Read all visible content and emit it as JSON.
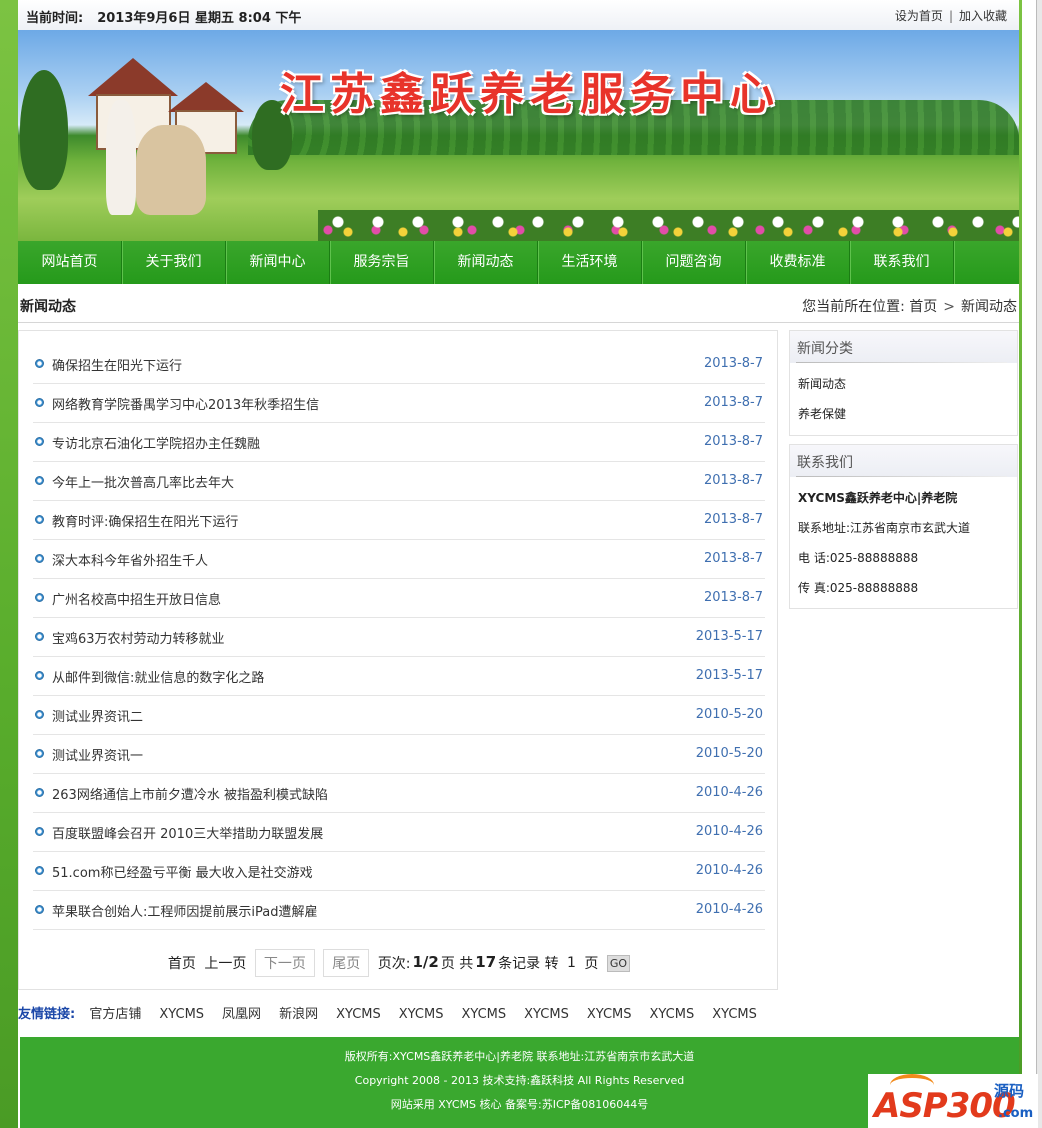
{
  "topbar": {
    "time_label": "当前时间:",
    "time_value": "2013年9月6日  星期五  8:04  下午",
    "set_home": "设为首页",
    "separator": "|",
    "add_fav": "加入收藏"
  },
  "banner": {
    "title": "江苏鑫跃养老服务中心"
  },
  "nav": [
    "网站首页",
    "关于我们",
    "新闻中心",
    "服务宗旨",
    "新闻动态",
    "生活环境",
    "问题咨询",
    "收费标准",
    "联系我们"
  ],
  "section": {
    "title": "新闻动态",
    "crumb_prefix": "您当前所在位置:",
    "crumb_home": "首页",
    "crumb_sep": ">",
    "crumb_current": "新闻动态"
  },
  "news": [
    {
      "title": "确保招生在阳光下运行",
      "date": "2013-8-7"
    },
    {
      "title": "网络教育学院番禺学习中心2013年秋季招生信",
      "date": "2013-8-7"
    },
    {
      "title": "专访北京石油化工学院招办主任魏融",
      "date": "2013-8-7"
    },
    {
      "title": "今年上一批次普高几率比去年大",
      "date": "2013-8-7"
    },
    {
      "title": "教育时评:确保招生在阳光下运行",
      "date": "2013-8-7"
    },
    {
      "title": "深大本科今年省外招生千人",
      "date": "2013-8-7"
    },
    {
      "title": "广州名校高中招生开放日信息",
      "date": "2013-8-7"
    },
    {
      "title": "宝鸡63万农村劳动力转移就业",
      "date": "2013-5-17"
    },
    {
      "title": "从邮件到微信:就业信息的数字化之路",
      "date": "2013-5-17"
    },
    {
      "title": "测试业界资讯二",
      "date": "2010-5-20"
    },
    {
      "title": "测试业界资讯一",
      "date": "2010-5-20"
    },
    {
      "title": "263网络通信上市前夕遭冷水 被指盈利模式缺陷",
      "date": "2010-4-26"
    },
    {
      "title": "百度联盟峰会召开 2010三大举措助力联盟发展",
      "date": "2010-4-26"
    },
    {
      "title": "51.com称已经盈亏平衡 最大收入是社交游戏",
      "date": "2010-4-26"
    },
    {
      "title": "苹果联合创始人:工程师因提前展示iPad遭解雇",
      "date": "2010-4-26"
    }
  ],
  "pager": {
    "first": "首页",
    "prev": "上一页",
    "next": "下一页",
    "last": "尾页",
    "page_label": "页次:",
    "page_value": "1/2",
    "page_unit": "页 共",
    "total": "17",
    "total_unit": "条记录 转",
    "jump_value": "1",
    "jump_unit": "页",
    "go": "GO"
  },
  "sidebar": {
    "category_title": "新闻分类",
    "categories": [
      "新闻动态",
      "养老保健"
    ],
    "contact_title": "联系我们",
    "contact": {
      "name": "XYCMS鑫跃养老中心|养老院",
      "address": "联系地址:江苏省南京市玄武大道",
      "phone": "电 话:025-88888888",
      "fax": "传 真:025-88888888"
    }
  },
  "friends": {
    "label": "友情链接:",
    "links": [
      "官方店铺",
      "XYCMS",
      "凤凰网",
      "新浪网",
      "XYCMS",
      "XYCMS",
      "XYCMS",
      "XYCMS",
      "XYCMS",
      "XYCMS",
      "XYCMS"
    ]
  },
  "footer": {
    "line1": "版权所有:XYCMS鑫跃养老中心|养老院  联系地址:江苏省南京市玄武大道",
    "line2": "Copyright 2008 - 2013  技术支持:鑫跃科技 All Rights Reserved",
    "line3": "网站采用 XYCMS 核心 备案号:苏ICP备08106044号"
  },
  "watermark": {
    "brand": "ASP300",
    "tag1": "源码",
    "tag2": ".com"
  }
}
